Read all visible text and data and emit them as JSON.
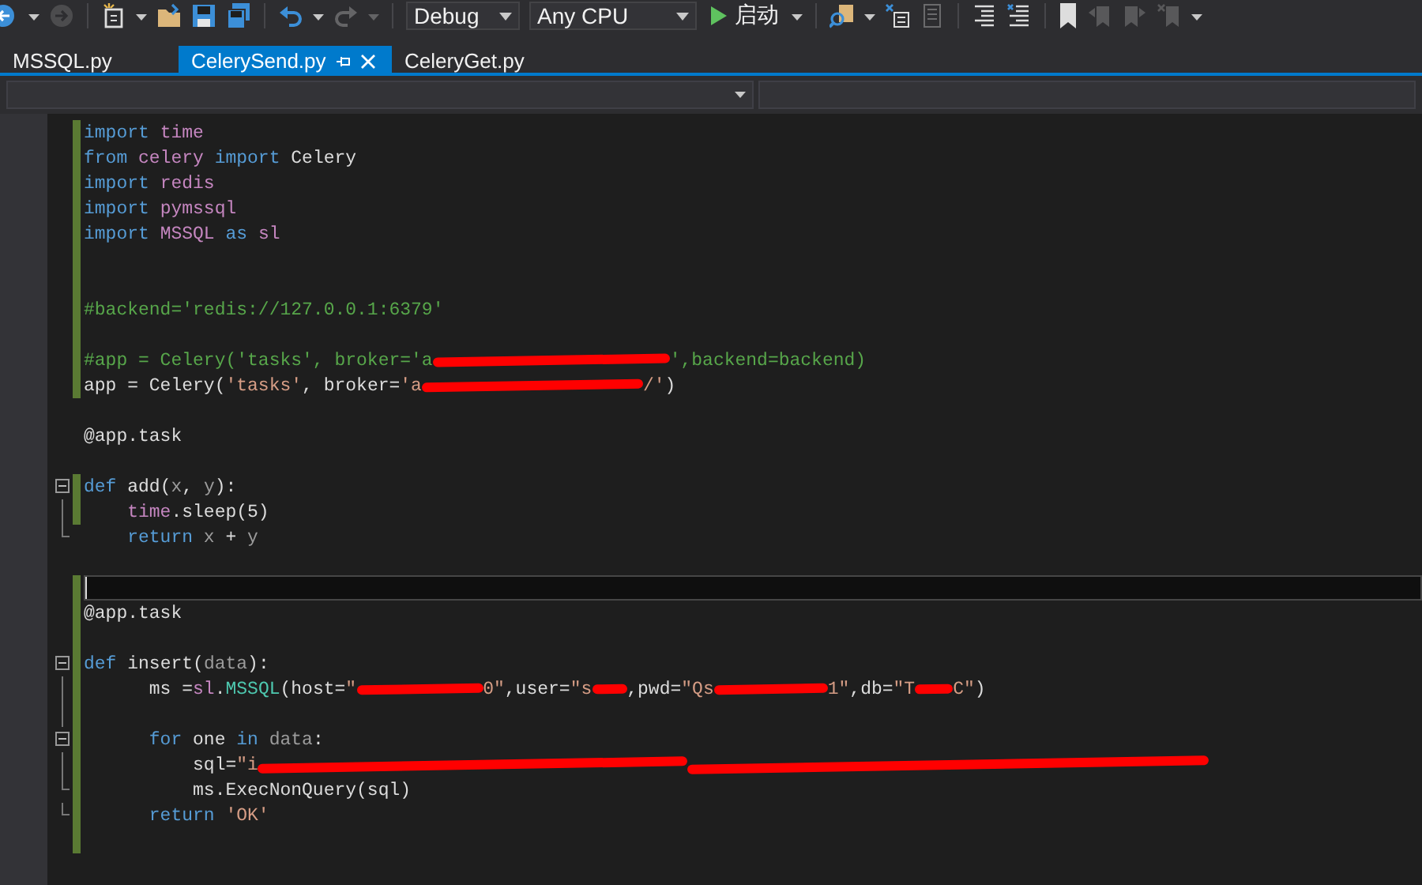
{
  "toolbar": {
    "items": [
      {
        "kind": "back",
        "disabled": false
      },
      {
        "kind": "caret",
        "disabled": false
      },
      {
        "kind": "forward",
        "disabled": true
      },
      {
        "kind": "sep"
      },
      {
        "kind": "new",
        "disabled": false
      },
      {
        "kind": "caret",
        "disabled": false
      },
      {
        "kind": "open",
        "disabled": false
      },
      {
        "kind": "save",
        "disabled": false
      },
      {
        "kind": "saveall",
        "disabled": false
      },
      {
        "kind": "sep"
      },
      {
        "kind": "undo",
        "disabled": false
      },
      {
        "kind": "caret",
        "disabled": false
      },
      {
        "kind": "redo",
        "disabled": true
      },
      {
        "kind": "caret",
        "disabled": true
      },
      {
        "kind": "sep"
      },
      {
        "kind": "combo",
        "text": "Debug",
        "wide": false
      },
      {
        "kind": "combo",
        "text": "Any CPU",
        "wide": true
      },
      {
        "kind": "start",
        "text": "启动"
      },
      {
        "kind": "caret",
        "disabled": false
      },
      {
        "kind": "sep"
      },
      {
        "kind": "find",
        "disabled": false
      },
      {
        "kind": "caret",
        "disabled": false
      },
      {
        "kind": "step",
        "disabled": false
      },
      {
        "kind": "list",
        "disabled": true
      },
      {
        "kind": "sep"
      },
      {
        "kind": "comment",
        "disabled": false
      },
      {
        "kind": "uncomment",
        "disabled": false
      },
      {
        "kind": "sep"
      },
      {
        "kind": "bookmark",
        "disabled": false
      },
      {
        "kind": "prevbm",
        "disabled": true
      },
      {
        "kind": "nextbm",
        "disabled": true
      },
      {
        "kind": "clearbm",
        "disabled": true
      },
      {
        "kind": "caret",
        "disabled": false
      }
    ]
  },
  "tabs": [
    {
      "label": "MSSQL.py",
      "selected": false
    },
    {
      "label": "CelerySend.py",
      "selected": true
    },
    {
      "label": "CeleryGet.py",
      "selected": false
    }
  ],
  "editor": {
    "lines": [
      {
        "changed": true,
        "tokens": [
          {
            "kind": "kw",
            "text": "import"
          },
          {
            "kind": "mod",
            "text": " time"
          }
        ]
      },
      {
        "changed": true,
        "tokens": [
          {
            "kind": "kw",
            "text": "from"
          },
          {
            "kind": "mod",
            "text": " celery"
          },
          {
            "kind": "kw",
            "text": " import"
          },
          {
            "kind": "txt",
            "text": " Celery"
          }
        ]
      },
      {
        "changed": true,
        "tokens": [
          {
            "kind": "kw",
            "text": "import"
          },
          {
            "kind": "mod",
            "text": " redis"
          }
        ]
      },
      {
        "changed": true,
        "tokens": [
          {
            "kind": "kw",
            "text": "import"
          },
          {
            "kind": "mod",
            "text": " pymssql"
          }
        ]
      },
      {
        "changed": true,
        "tokens": [
          {
            "kind": "kw",
            "text": "import"
          },
          {
            "kind": "mod",
            "text": " MSSQL"
          },
          {
            "kind": "kw",
            "text": " as"
          },
          {
            "kind": "mod",
            "text": " sl"
          }
        ]
      },
      {
        "changed": true
      },
      {
        "changed": true
      },
      {
        "changed": true,
        "tokens": [
          {
            "kind": "com",
            "text": "#backend='redis://127.0.0.1:6379'"
          }
        ]
      },
      {
        "changed": true
      },
      {
        "changed": true,
        "tokens": [
          {
            "kind": "com",
            "text": "#app = Celery('tasks', broker='a"
          },
          {
            "kind": "redact"
          },
          {
            "kind": "com",
            "text": "',backend=backend)"
          }
        ]
      },
      {
        "changed": true,
        "tokens": [
          {
            "kind": "txt",
            "text": "app = Celery("
          },
          {
            "kind": "str",
            "text": "'tasks'"
          },
          {
            "kind": "txt",
            "text": ", broker="
          },
          {
            "kind": "str",
            "text": "'a"
          },
          {
            "kind": "redact"
          },
          {
            "kind": "str",
            "text": "/'"
          },
          {
            "kind": "txt",
            "text": ")"
          }
        ]
      },
      {
        "changed": false
      },
      {
        "changed": false,
        "tokens": [
          {
            "kind": "txt",
            "text": "@app.task"
          }
        ]
      },
      {
        "changed": false
      },
      {
        "changed": true,
        "expanded": true,
        "tokens": [
          {
            "kind": "kw",
            "text": "def"
          },
          {
            "kind": "txt",
            "text": " add("
          },
          {
            "kind": "param",
            "text": "x"
          },
          {
            "kind": "txt",
            "text": ", "
          },
          {
            "kind": "param",
            "text": "y"
          },
          {
            "kind": "txt",
            "text": "):"
          }
        ]
      },
      {
        "changed": true,
        "tokens": [
          {
            "kind": "mod",
            "text": "    time"
          },
          {
            "kind": "txt",
            "text": ".sleep(5)"
          }
        ]
      },
      {
        "changed": false,
        "fold_end": true,
        "tokens": [
          {
            "kind": "kw",
            "text": "    return"
          },
          {
            "kind": "param",
            "text": " x"
          },
          {
            "kind": "txt",
            "text": " + "
          },
          {
            "kind": "param",
            "text": "y"
          }
        ]
      },
      {
        "changed": false
      },
      {
        "changed": true,
        "current": true
      },
      {
        "changed": true,
        "tokens": [
          {
            "kind": "txt",
            "text": "@app.task"
          }
        ]
      },
      {
        "changed": true
      },
      {
        "changed": true,
        "expanded": true,
        "tokens": [
          {
            "kind": "kw",
            "text": "def"
          },
          {
            "kind": "txt",
            "text": " insert("
          },
          {
            "kind": "param",
            "text": "data"
          },
          {
            "kind": "txt",
            "text": "):"
          }
        ]
      },
      {
        "changed": true,
        "tokens": [
          {
            "kind": "txt",
            "text": "      ms ="
          },
          {
            "kind": "mod",
            "text": "sl"
          },
          {
            "kind": "txt",
            "text": "."
          },
          {
            "kind": "cls",
            "text": "MSSQL"
          },
          {
            "kind": "txt",
            "text": "(host="
          },
          {
            "kind": "str",
            "text": "\""
          },
          {
            "kind": "redact"
          },
          {
            "kind": "str",
            "text": "0\""
          },
          {
            "kind": "txt",
            "text": ",user="
          },
          {
            "kind": "str",
            "text": "\"s"
          },
          {
            "kind": "redact"
          },
          {
            "kind": "txt",
            "text": ",pwd="
          },
          {
            "kind": "str",
            "text": "\"Qs"
          },
          {
            "kind": "redact"
          },
          {
            "kind": "str",
            "text": "1\""
          },
          {
            "kind": "txt",
            "text": ",db="
          },
          {
            "kind": "str",
            "text": "\"T"
          },
          {
            "kind": "redact"
          },
          {
            "kind": "str",
            "text": "C\""
          },
          {
            "kind": "txt",
            "text": ")"
          }
        ]
      },
      {
        "changed": true
      },
      {
        "changed": true,
        "expanded": true,
        "tokens": [
          {
            "kind": "kw",
            "text": "      for"
          },
          {
            "kind": "txt",
            "text": " one "
          },
          {
            "kind": "kw",
            "text": "in"
          },
          {
            "kind": "param",
            "text": " data"
          },
          {
            "kind": "txt",
            "text": ":"
          }
        ]
      },
      {
        "changed": true,
        "tokens": [
          {
            "kind": "txt",
            "text": "          sql="
          },
          {
            "kind": "str",
            "text": "\"i"
          },
          {
            "kind": "redact"
          },
          {
            "kind": "redact"
          }
        ]
      },
      {
        "changed": true,
        "fold_end": true,
        "tokens": [
          {
            "kind": "txt",
            "text": "          ms.ExecNonQuery(sql)"
          }
        ]
      },
      {
        "changed": true,
        "fold_end": true,
        "tokens": [
          {
            "kind": "kw",
            "text": "      return"
          },
          {
            "kind": "str",
            "text": " 'OK'"
          }
        ]
      },
      {
        "changed": true
      }
    ]
  }
}
